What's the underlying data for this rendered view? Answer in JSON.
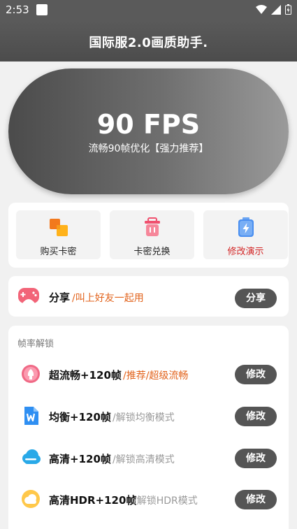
{
  "status": {
    "time": "2:53"
  },
  "header": {
    "title": "国际服2.0画质助手."
  },
  "hero": {
    "fps": "90 FPS",
    "subtitle": "流畅90帧优化【强力推荐】"
  },
  "actions": [
    {
      "label": "购买卡密",
      "icon": "cube-icon"
    },
    {
      "label": "卡密兑换",
      "icon": "trash-icon"
    },
    {
      "label": "修改演示",
      "icon": "lightning-icon"
    }
  ],
  "share": {
    "title": "分享",
    "desc": "/叫上好友一起用",
    "button": "分享"
  },
  "unlock": {
    "section_title": "帧率解锁",
    "modes": [
      {
        "title": "超流畅+120帧",
        "desc": "/推荐/超级流畅",
        "button": "修改"
      },
      {
        "title": "均衡+120帧",
        "desc": "/解锁均衡模式",
        "button": "修改"
      },
      {
        "title": "高清+120帧",
        "desc": "/解锁高清模式",
        "button": "修改"
      },
      {
        "title": "高清HDR+120帧",
        "desc": "/解锁HDR模式",
        "button": "修改"
      }
    ]
  },
  "colors": {
    "accent_orange": "#e2631c",
    "muted_gray": "#9a9a9a",
    "demo_red": "#d32626",
    "button_dark": "#555555"
  }
}
